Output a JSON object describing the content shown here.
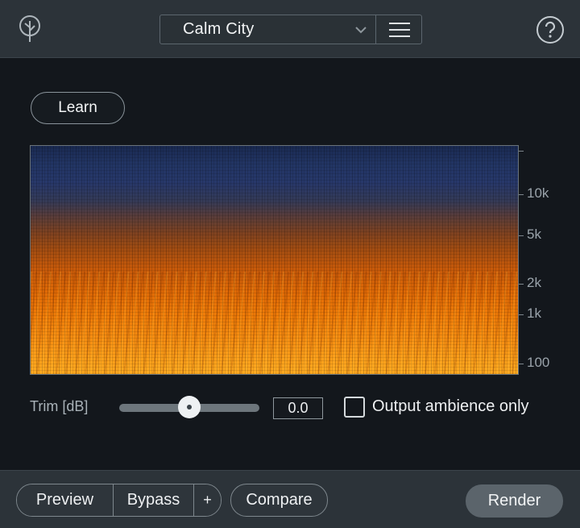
{
  "header": {
    "logo_icon": "tree-icon",
    "preset_name": "Calm City",
    "dropdown_icon": "chevron-down-icon",
    "menu_icon": "hamburger-menu-icon",
    "help_icon": "question-circle-icon"
  },
  "learn_label": "Learn",
  "spectrogram": {
    "freq_labels": [
      "10k",
      "5k",
      "2k",
      "1k",
      "100"
    ]
  },
  "trim": {
    "label": "Trim [dB]",
    "value": "0.0",
    "slider_position": 0.5
  },
  "output_ambience": {
    "label": "Output ambience only",
    "checked": false
  },
  "footer": {
    "preview_label": "Preview",
    "bypass_label": "Bypass",
    "plus_label": "+",
    "compare_label": "Compare",
    "render_label": "Render"
  },
  "colors": {
    "header_bg": "#2c3339",
    "body_bg": "#13171c",
    "render_bg": "#5b646b"
  }
}
